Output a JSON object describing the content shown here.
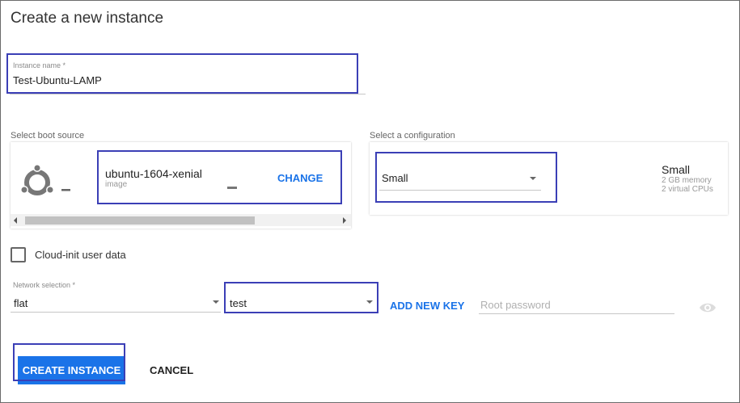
{
  "page": {
    "title": "Create a new instance"
  },
  "instance": {
    "label": "Instance name *",
    "value": "Test-Ubuntu-LAMP"
  },
  "boot": {
    "section_label": "Select boot source",
    "icon": "ubuntu-logo-icon",
    "image_name": "ubuntu-1604-xenial",
    "image_sub": "image",
    "change_label": "CHANGE"
  },
  "config": {
    "section_label": "Select a configuration",
    "selected": "Small",
    "summary_title": "Small",
    "summary_memory": "2 GB memory",
    "summary_cpus": "2 virtual CPUs"
  },
  "cloud_init": {
    "label": "Cloud-init user data",
    "checked": false
  },
  "network": {
    "label": "Network selection *",
    "value": "flat"
  },
  "key": {
    "value": "test",
    "add_label": "ADD NEW KEY"
  },
  "password": {
    "placeholder": "Root password",
    "icon": "eye-icon"
  },
  "actions": {
    "create_label": "CREATE INSTANCE",
    "cancel_label": "CANCEL"
  },
  "colors": {
    "accent": "#1a73e8",
    "highlight": "#3b3fb6"
  }
}
